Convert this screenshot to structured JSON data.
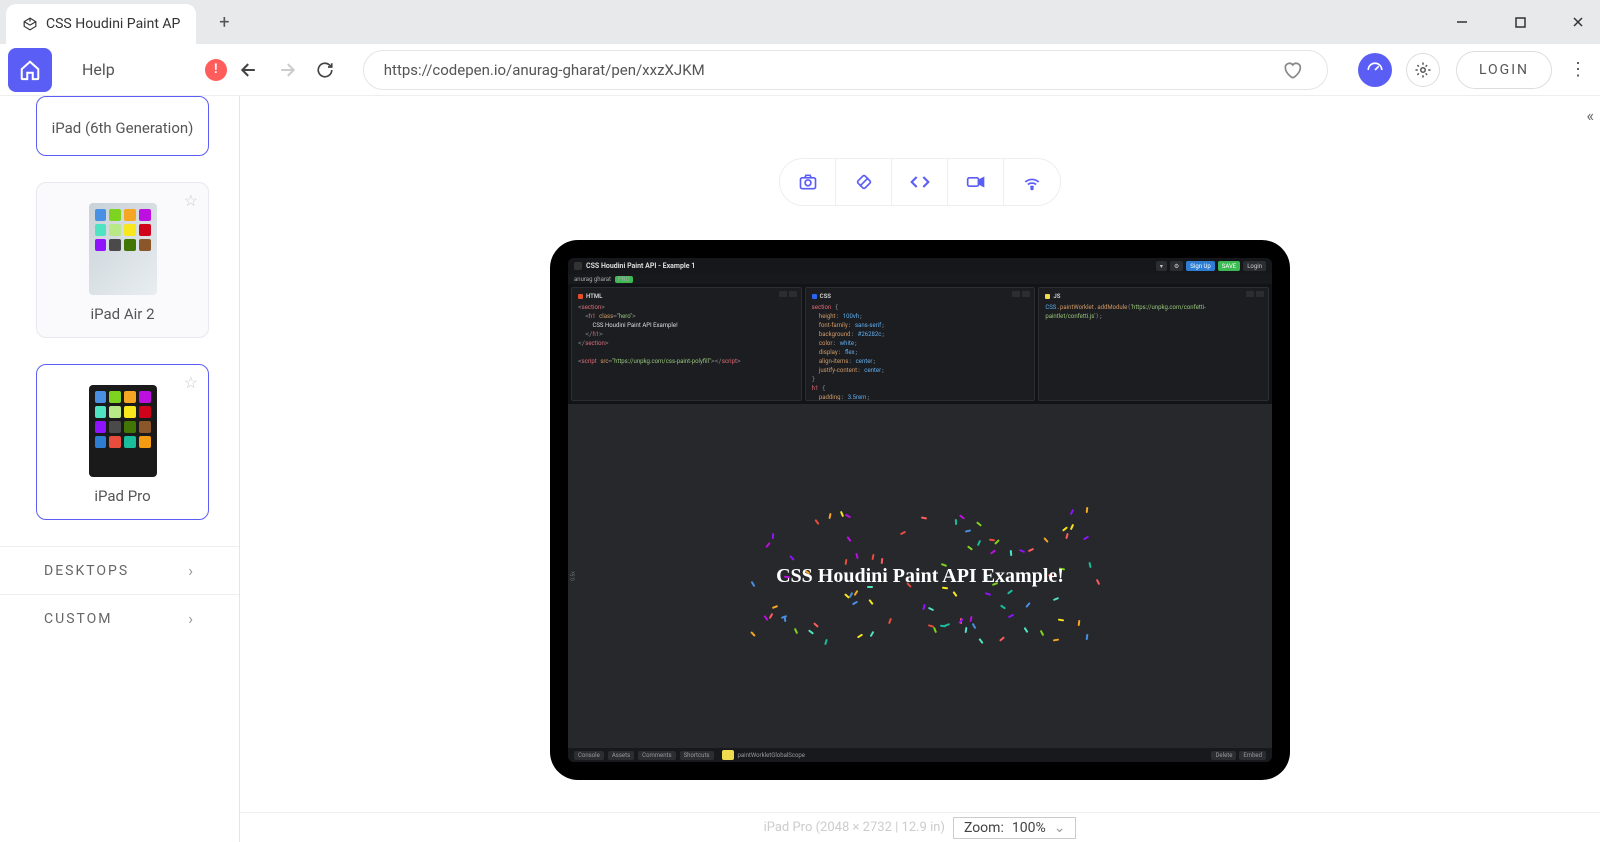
{
  "tab": {
    "title": "CSS Houdini Paint AP"
  },
  "toolbar": {
    "help": "Help",
    "url": "https://codepen.io/anurag-gharat/pen/xxzXJKM",
    "login": "LOGIN"
  },
  "sidebar": {
    "devices": [
      {
        "label": "iPad (6th Generation)",
        "selected": true,
        "thumb": false
      },
      {
        "label": "iPad Air 2",
        "selected": false,
        "thumb": true
      },
      {
        "label": "iPad Pro",
        "selected": true,
        "thumb": true
      }
    ],
    "categories": [
      {
        "label": "DESKTOPS"
      },
      {
        "label": "CUSTOM"
      }
    ]
  },
  "codepen": {
    "title": "CSS Houdini Paint API - Example 1",
    "save": "SAVE",
    "panels": {
      "html": "HTML",
      "css": "CSS",
      "js": "JS"
    },
    "preview_text": "CSS Houdini Paint API Example!",
    "footer": [
      "Console",
      "Assets",
      "Comments",
      "Shortcuts"
    ]
  },
  "bottom": {
    "zoom_label": "Zoom:",
    "zoom_value": "100%"
  }
}
